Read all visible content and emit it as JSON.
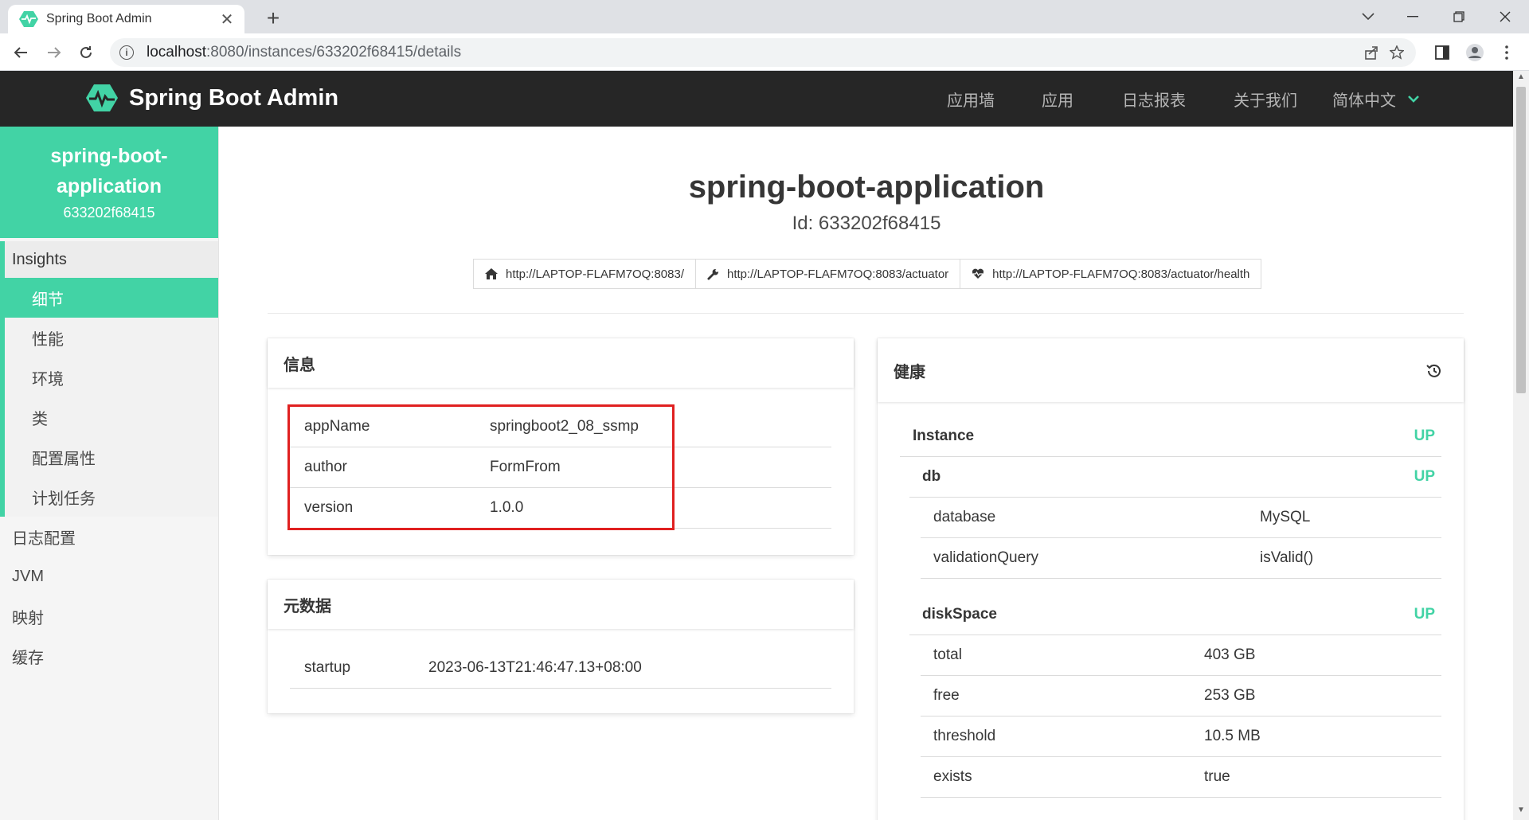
{
  "browser": {
    "tab_title": "Spring Boot Admin",
    "tab_close": "✕",
    "new_tab": "+",
    "url_host": "localhost",
    "url_rest": ":8080/instances/633202f68415/details",
    "window_controls": [
      "chevron-down",
      "minimize",
      "restore",
      "close"
    ]
  },
  "header": {
    "brand": "Spring Boot Admin",
    "nav": [
      "应用墙",
      "应用",
      "日志报表",
      "关于我们",
      "简体中文"
    ]
  },
  "sidebar": {
    "app_name": "spring-boot-application",
    "app_name_line1": "spring-boot-",
    "app_name_line2": "application",
    "instance_id": "633202f68415",
    "group_title": "Insights",
    "group_items": [
      "细节",
      "性能",
      "环境",
      "类",
      "配置属性",
      "计划任务"
    ],
    "items": [
      "日志配置",
      "JVM",
      "映射",
      "缓存"
    ]
  },
  "main": {
    "title": "spring-boot-application",
    "subtitle": "Id: 633202f68415",
    "links": [
      {
        "label": "http://LAPTOP-FLAFM7OQ:8083/",
        "icon": "home-icon"
      },
      {
        "label": "http://LAPTOP-FLAFM7OQ:8083/actuator",
        "icon": "wrench-icon"
      },
      {
        "label": "http://LAPTOP-FLAFM7OQ:8083/actuator/health",
        "icon": "heartbeat-icon"
      }
    ]
  },
  "info": {
    "title": "信息",
    "rows": [
      {
        "key": "appName",
        "value": "springboot2_08_ssmp"
      },
      {
        "key": "author",
        "value": "FormFrom"
      },
      {
        "key": "version",
        "value": "1.0.0"
      }
    ]
  },
  "metadata": {
    "title": "元数据",
    "rows": [
      {
        "key": "startup",
        "value": "2023-06-13T21:46:47.13+08:00"
      }
    ]
  },
  "health": {
    "title": "健康",
    "instance": {
      "label": "Instance",
      "status": "UP"
    },
    "db": {
      "label": "db",
      "status": "UP",
      "rows": [
        {
          "key": "database",
          "value": "MySQL"
        },
        {
          "key": "validationQuery",
          "value": "isValid()"
        }
      ]
    },
    "disk": {
      "label": "diskSpace",
      "status": "UP",
      "rows": [
        {
          "key": "total",
          "value": "403 GB"
        },
        {
          "key": "free",
          "value": "253 GB"
        },
        {
          "key": "threshold",
          "value": "10.5 MB"
        },
        {
          "key": "exists",
          "value": "true"
        }
      ]
    }
  },
  "colors": {
    "brand": "#42d3a5",
    "header_bg": "#262626",
    "highlight": "#e02020"
  }
}
